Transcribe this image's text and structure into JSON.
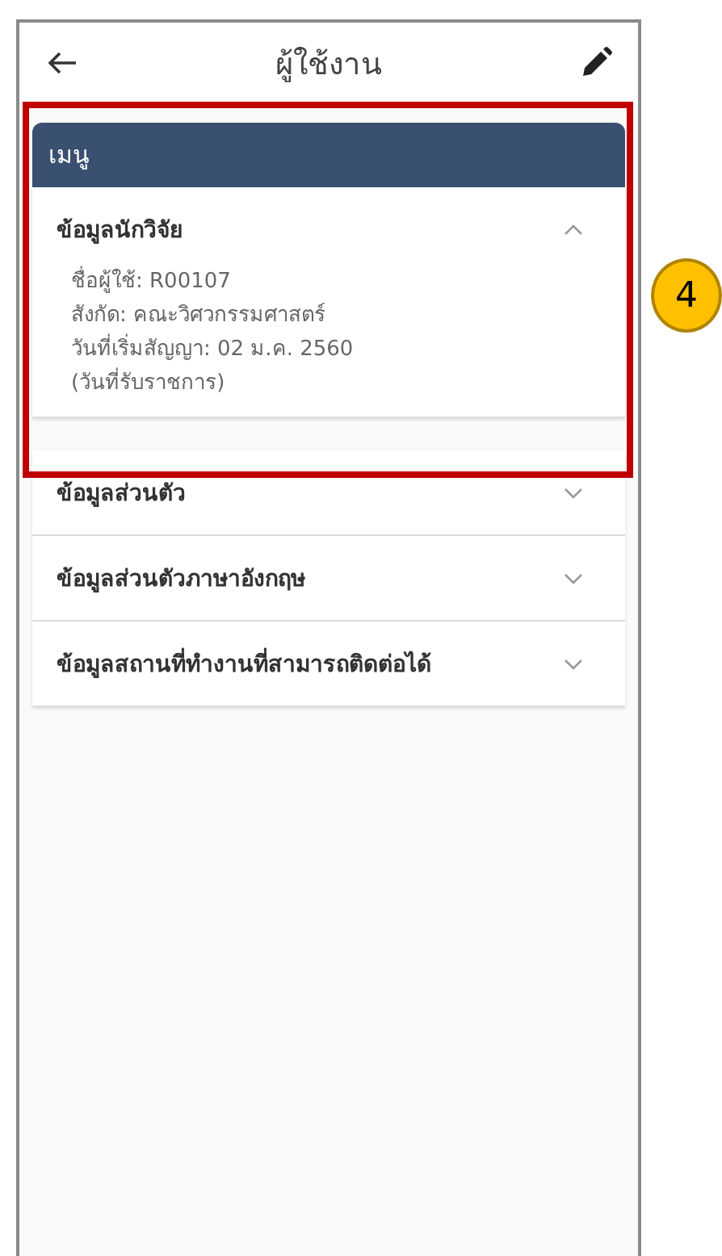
{
  "header": {
    "title": "ผู้ใช้งาน"
  },
  "menu": {
    "title": "เมนู"
  },
  "sections": [
    {
      "title": "ข้อมูลนักวิจัย",
      "expanded": true,
      "details": [
        "ชื่อผู้ใช้: R00107",
        "สังกัด: คณะวิศวกรรมศาสตร์",
        "วันที่เริ่มสัญญา: 02 ม.ค. 2560",
        "(วันที่รับราชการ)"
      ]
    },
    {
      "title": "ข้อมูลส่วนตัว",
      "expanded": false
    },
    {
      "title": "ข้อมูลส่วนตัวภาษาอังกฤษ",
      "expanded": false
    },
    {
      "title": "ข้อมูลสถานที่ทำงานที่สามารถติดต่อได้",
      "expanded": false
    }
  ],
  "callout": {
    "number": "4"
  }
}
